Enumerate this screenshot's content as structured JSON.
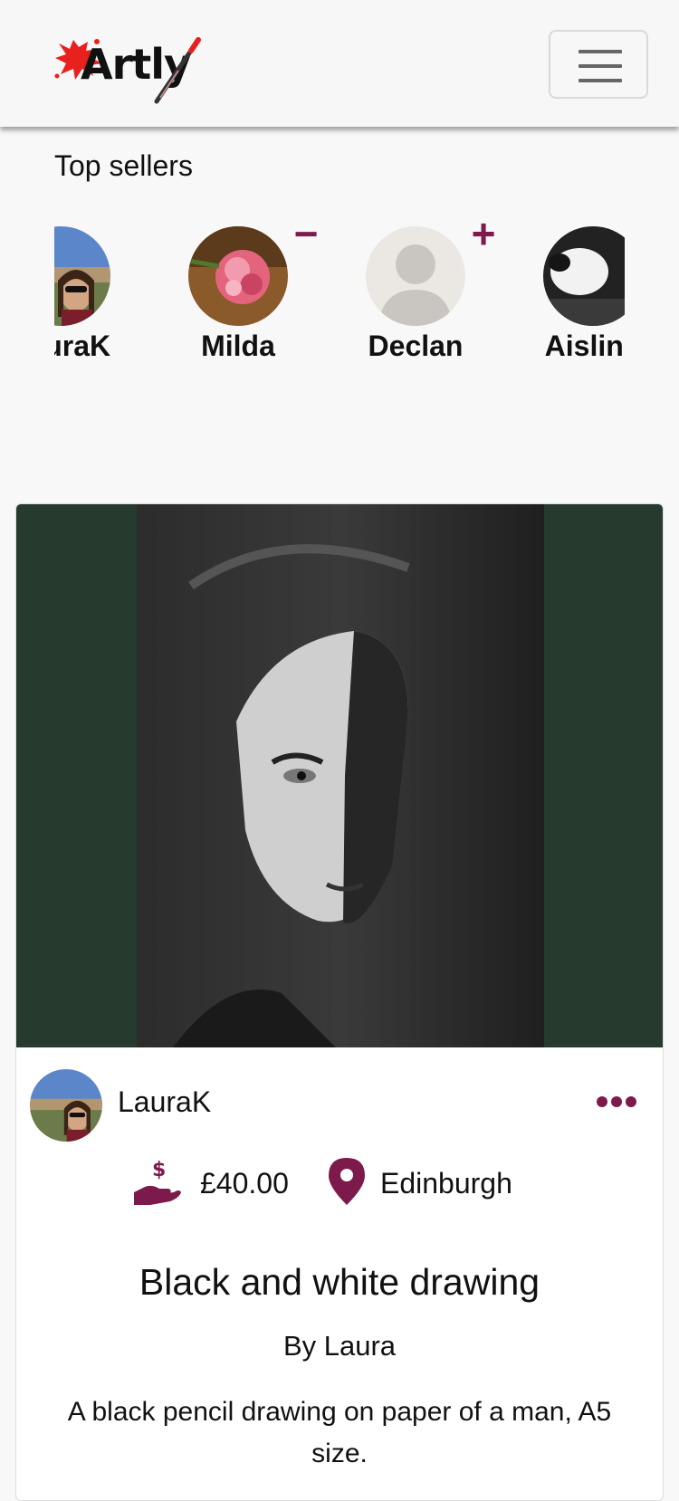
{
  "app": {
    "logo_text": "Artly",
    "menu_toggle_icon": "hamburger-icon"
  },
  "colors": {
    "accent": "#7c1b4b",
    "image_background": "#263a2d",
    "page_background": "#f8f8f8"
  },
  "top_sellers": {
    "title": "Top sellers",
    "sellers": [
      {
        "name": "LauraK",
        "follow_icon": ""
      },
      {
        "name": "Milda",
        "follow_icon": "minus-icon",
        "follow_symbol": "−"
      },
      {
        "name": "Declan",
        "follow_icon": "plus-icon",
        "follow_symbol": "+"
      },
      {
        "name": "Aisling",
        "follow_icon": ""
      }
    ]
  },
  "post": {
    "author": "LauraK",
    "more_icon": "more-options-icon",
    "price_icon": "hand-holding-dollar-icon",
    "price": "£40.00",
    "location_icon": "map-marker-icon",
    "location": "Edinburgh",
    "title": "Black and white drawing",
    "by": "By Laura",
    "description": "A black pencil drawing on paper of a man, A5 size."
  }
}
